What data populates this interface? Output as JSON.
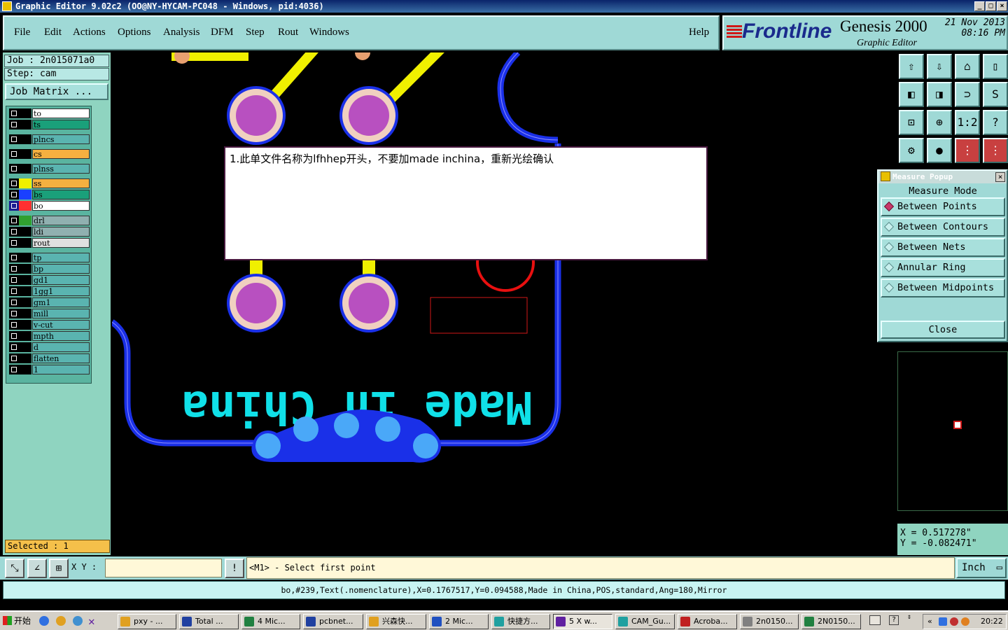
{
  "title_bar": {
    "text": "Graphic Editor 9.02c2 (OO@NY-HYCAM-PC048 - Windows, pid:4036)"
  },
  "menu": {
    "items": [
      "File",
      "Edit",
      "Actions",
      "Options",
      "Analysis",
      "DFM",
      "Step",
      "Rout",
      "Windows"
    ],
    "help": "Help"
  },
  "brand": {
    "logo": "Frontline",
    "product": "Genesis 2000",
    "subtitle": "Graphic Editor",
    "date": "21 Nov 2013",
    "time": "08:16 PM"
  },
  "job": {
    "job_label": "Job : 2n015071a0",
    "step_label": "Step: cam",
    "matrix_button": "Job Matrix ..."
  },
  "layers": [
    {
      "name": "to",
      "color": "#000000",
      "bg": "#ffffff"
    },
    {
      "name": "ts",
      "color": "#000000",
      "bg": "#1aa07a"
    },
    {
      "name": "plncs",
      "color": "#000000",
      "bg": "#5ab4b0"
    },
    {
      "name": "cs",
      "color": "#000000",
      "bg": "#f5b040"
    },
    {
      "name": "plnss",
      "color": "#000000",
      "bg": "#5ab4b0"
    },
    {
      "name": "ss",
      "color": "#f0f000",
      "bg": "#f5b040"
    },
    {
      "name": "bs",
      "color": "#1a40ff",
      "bg": "#1aa07a"
    },
    {
      "name": "bo",
      "color": "#ff3030",
      "bg": "#ffffff"
    },
    {
      "name": "drl",
      "color": "#30a030",
      "bg": "#90b0b0"
    },
    {
      "name": "ldi",
      "color": "#000000",
      "bg": "#90b0b0"
    },
    {
      "name": "rout",
      "color": "#000000",
      "bg": "#e0e0e0"
    },
    {
      "name": "tp",
      "color": "#000000",
      "bg": "#5ab4b0"
    },
    {
      "name": "bp",
      "color": "#000000",
      "bg": "#5ab4b0"
    },
    {
      "name": "gd1",
      "color": "#000000",
      "bg": "#5ab4b0"
    },
    {
      "name": "1gg1",
      "color": "#000000",
      "bg": "#5ab4b0"
    },
    {
      "name": "gm1",
      "color": "#000000",
      "bg": "#5ab4b0"
    },
    {
      "name": "mill",
      "color": "#000000",
      "bg": "#5ab4b0"
    },
    {
      "name": "v-cut",
      "color": "#000000",
      "bg": "#5ab4b0"
    },
    {
      "name": "mpth",
      "color": "#000000",
      "bg": "#5ab4b0"
    },
    {
      "name": "d",
      "color": "#000000",
      "bg": "#5ab4b0"
    },
    {
      "name": "flatten",
      "color": "#000000",
      "bg": "#5ab4b0"
    },
    {
      "name": "1",
      "color": "#000000",
      "bg": "#5ab4b0"
    }
  ],
  "selected": "Selected : 1",
  "note": "1.此单文件名称为lfhhep开头，不要加made inchina，重新光绘确认",
  "canvas_text": "Made in China",
  "measure": {
    "title": "Measure Popup",
    "mode_label": "Measure Mode",
    "options": [
      "Between Points",
      "Between Contours",
      "Between Nets",
      "Annular Ring",
      "Between Midpoints"
    ],
    "selected_option": "Between Points",
    "close": "Close"
  },
  "coords": {
    "x": "X  =  0.517278\"",
    "y": "Y  = -0.082471\""
  },
  "command": {
    "xy_label": "X Y :",
    "xy_value": "",
    "prompt": "<M1> - Select first point",
    "unit": "Inch"
  },
  "status": "bo,#239,Text(.nomenclature),X=0.1767517,Y=0.094588,Made in China,POS,standard,Ang=180,Mirror",
  "taskbar": {
    "start": "开始",
    "tasks": [
      "pxy - ...",
      "Total ...",
      "4 Mic...",
      "pcbnet...",
      "兴森快...",
      "2 Mic...",
      "快捷方...",
      "5 X w...",
      "CAM_Gu...",
      "Acroba...",
      "2n0150...",
      "2N0150..."
    ],
    "active_task": "5 X w...",
    "clock": "20:22"
  }
}
